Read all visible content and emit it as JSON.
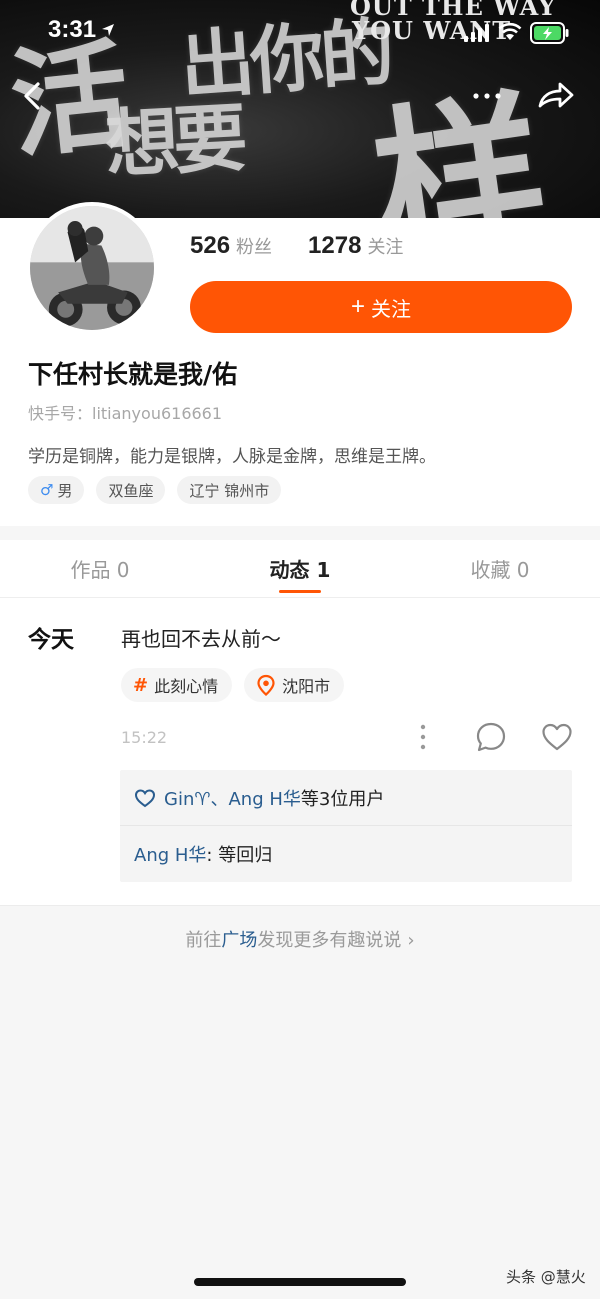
{
  "status_bar": {
    "time": "3:31"
  },
  "banner": {
    "calligraphy": [
      "活",
      "出你的",
      "想要",
      "样子"
    ],
    "english": [
      "OUT THE WAY",
      "YOU WANT"
    ]
  },
  "profile": {
    "fans_count": "526",
    "fans_label": "粉丝",
    "following_count": "1278",
    "following_label": "关注",
    "follow_button": "关注",
    "follow_plus": "+",
    "username": "下任村长就是我/佑",
    "kuaishou_id": "快手号：litianyou616661",
    "bio": "学历是铜牌，能力是银牌，人脉是金牌，思维是王牌。",
    "tags": {
      "gender_symbol": "♂",
      "gender": "男",
      "zodiac": "双鱼座",
      "location": "辽宁 锦州市"
    }
  },
  "tabs": [
    {
      "label": "作品 0"
    },
    {
      "label": "动态 1"
    },
    {
      "label": "收藏 0"
    }
  ],
  "moment": {
    "day": "今天",
    "text": "再也回不去从前～",
    "topic_hash": "#",
    "topic": "此刻心情",
    "place": "沈阳市",
    "time": "15:22",
    "likers": "Gin♈、Ang H华",
    "likers_suffix": "等3位用户",
    "comment_user": "Ang H华",
    "comment_text": ": 等回归"
  },
  "discover": {
    "prefix": "前往",
    "link": "广场",
    "suffix": "发现更多有趣说说",
    "chevron": "›"
  },
  "watermark": "头条 @慧火",
  "colors": {
    "accent": "#ff5505",
    "link": "#2a5d8f"
  },
  "icons": [
    "back-icon",
    "more-icon",
    "share-icon",
    "male-icon",
    "location-pin-icon",
    "more-vertical-icon",
    "comment-icon",
    "heart-icon"
  ]
}
